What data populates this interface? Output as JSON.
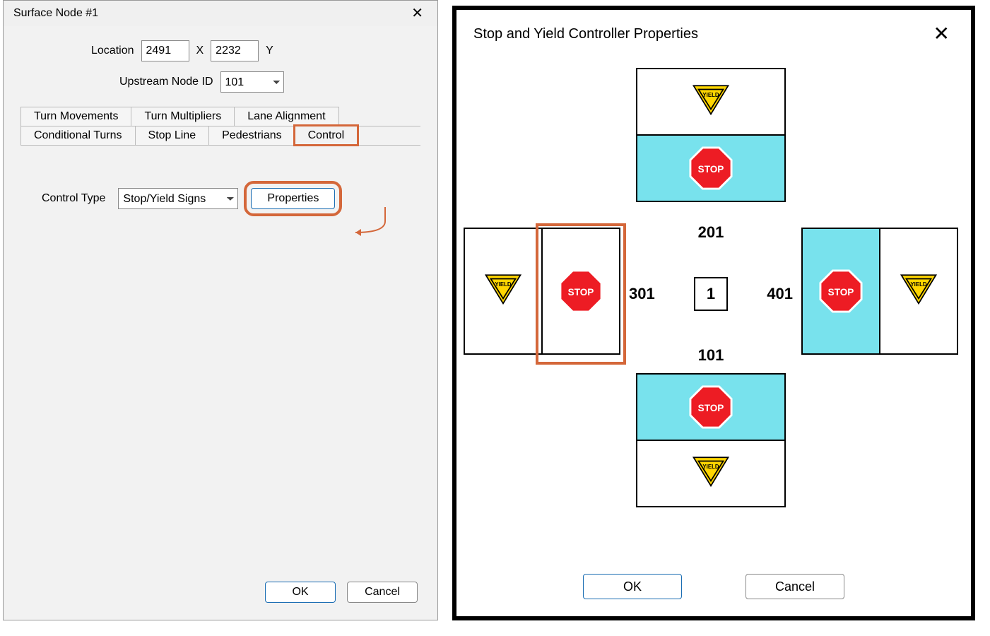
{
  "dialog1": {
    "title": "Surface Node #1",
    "location": {
      "label": "Location",
      "x": "2491",
      "xlabel": "X",
      "y": "2232",
      "ylabel": "Y"
    },
    "upstream": {
      "label": "Upstream Node ID",
      "value": "101"
    },
    "tabs_row1": [
      "Turn Movements",
      "Turn Multipliers",
      "Lane Alignment"
    ],
    "tabs_row2": [
      "Conditional Turns",
      "Stop Line",
      "Pedestrians",
      "Control"
    ],
    "control": {
      "label": "Control Type",
      "value": "Stop/Yield Signs",
      "properties_btn": "Properties"
    },
    "buttons": {
      "ok": "OK",
      "cancel": "Cancel"
    }
  },
  "dialog2": {
    "title": "Stop and Yield Controller Properties",
    "node_ids": {
      "north": "201",
      "south": "101",
      "west": "301",
      "east": "401",
      "center": "1"
    },
    "approaches": {
      "north": {
        "outer": "yield",
        "inner": "stop",
        "inner_selected": true
      },
      "south": {
        "inner": "stop",
        "outer": "yield",
        "inner_selected": true
      },
      "west": {
        "outer": "yield",
        "inner": "stop",
        "inner_selected": false
      },
      "east": {
        "inner": "stop",
        "outer": "yield",
        "inner_selected": true
      }
    },
    "sign_labels": {
      "stop": "STOP",
      "yield": "YIELD"
    },
    "buttons": {
      "ok": "OK",
      "cancel": "Cancel"
    },
    "annotations": {
      "highlight_color": "#d4673a",
      "highlighted_tab": "Control",
      "arrow_from": "Control tab",
      "arrow_to": "Properties button",
      "highlighted_approach": "west-stop"
    }
  }
}
